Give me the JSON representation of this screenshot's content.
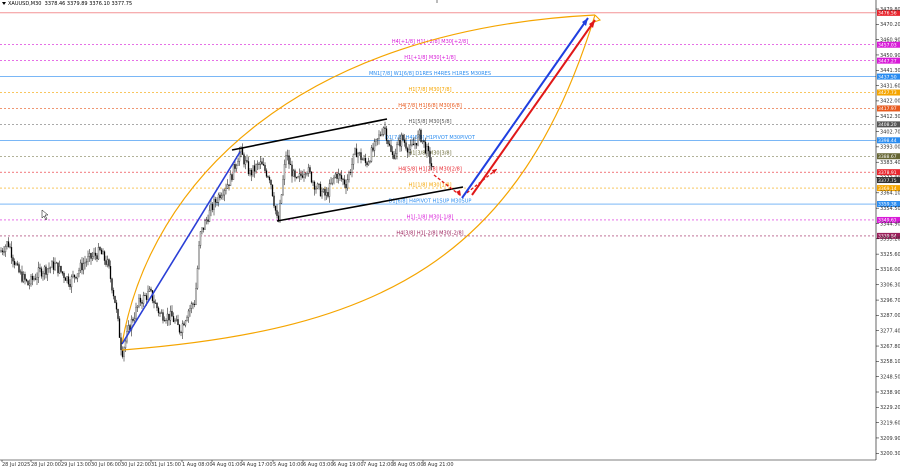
{
  "header": {
    "symbol": "XAUUSD,M30",
    "ohlc": "3378.46 3379.89 3376.10 3377.75"
  },
  "colors": {
    "candle": "#000000",
    "grid": "#c8c8c8",
    "channel": "#000000",
    "impulse": "#2a3fd6",
    "arc": "#f5a500",
    "up_blue": "#1f3fe0",
    "up_red": "#e01818",
    "dash_red": "#e01818"
  },
  "chart_data": {
    "type": "candlestick",
    "title": "",
    "xlabel": "",
    "ylabel": "",
    "ylim": [
      3200.0,
      3482.0
    ],
    "y_ticks": [
      "3479.80",
      "3470.20",
      "3460.90",
      "3450.90",
      "3441.30",
      "3431.60",
      "3422.00",
      "3412.30",
      "3402.70",
      "3393.00",
      "3383.40",
      "3373.80",
      "3364.10",
      "3354.50",
      "3344.90",
      "3335.20",
      "3325.60",
      "3316.00",
      "3306.30",
      "3296.70",
      "3287.00",
      "3277.40",
      "3267.80",
      "3258.10",
      "3248.50",
      "3238.90",
      "3229.20",
      "3219.60",
      "3209.90",
      "3200.30"
    ],
    "x_ticks": [
      "28 Jul 2025",
      "28 Jul 20:00",
      "29 Jul 13:00",
      "30 Jul 06:00",
      "30 Jul 22:00",
      "31 Jul 15:00",
      "1 Aug 08:00",
      "4 Aug 01:00",
      "4 Aug 17:00",
      "5 Aug 10:00",
      "6 Aug 03:00",
      "6 Aug 19:00",
      "7 Aug 12:00",
      "8 Aug 05:00",
      "8 Aug 21:00"
    ],
    "grid": false,
    "price_levels": [
      {
        "price": 3476.56,
        "label": "",
        "color": "#e8262e",
        "style": "solid",
        "badge": "3476.56"
      },
      {
        "price": 3457.03,
        "label": "H4[+1/8] H1[+2/8] M30[+2/8]",
        "color": "#d81bd8",
        "style": "dashed",
        "badge": "3457.03"
      },
      {
        "price": 3447.27,
        "label": "H1[+1/8] M30[+1/8]",
        "color": "#d81bd8",
        "style": "dashed",
        "badge": "3447.27"
      },
      {
        "price": 3437.5,
        "label": "MN1[7/8] W1[6/8] D1RES H4RES H1RES M30RES",
        "color": "#2a8cf0",
        "style": "solid",
        "badge": "3437.50"
      },
      {
        "price": 3427.73,
        "label": "H1[7/8] M30[7/8]",
        "color": "#f5a500",
        "style": "dashed",
        "badge": "3427.73"
      },
      {
        "price": 3417.97,
        "label": "H4[7/8] H1[6/8] M30[6/8]",
        "color": "#e85a1e",
        "style": "dashed",
        "badge": "3417.97"
      },
      {
        "price": 3408.2,
        "label": "H1[5/8] M30[5/8]",
        "color": "#555555",
        "style": "dashed",
        "badge": "3408.20"
      },
      {
        "price": 3398.44,
        "label": "D1[7/8] H4[6/8] H1PIVOT M30PIVOT",
        "color": "#2a8cf0",
        "style": "solid",
        "badge": "3398.44"
      },
      {
        "price": 3388.67,
        "label": "H1[3/8] M30[3/8]",
        "color": "#666633",
        "style": "dashed",
        "badge": "3388.67"
      },
      {
        "price": 3378.91,
        "label": "H4[5/8] H1[2/8] M30[2/8]",
        "color": "#e8262e",
        "style": "dashed",
        "badge": "3378.91"
      },
      {
        "price": 3369.14,
        "label": "H1[1/8] M30[1/8]",
        "color": "#f5a500",
        "style": "dashed",
        "badge": "3369.14"
      },
      {
        "price": 3359.38,
        "label": "D1[6/8] H4PIVOT H1SUP M30SUP",
        "color": "#2a8cf0",
        "style": "solid",
        "badge": "3359.38"
      },
      {
        "price": 3349.61,
        "label": "H1[-1/8] M30[-1/8]",
        "color": "#d81bd8",
        "style": "dashed",
        "badge": "3349.61"
      },
      {
        "price": 3339.84,
        "label": "H4[3/8] H1[-2/8] M30[-2/8]",
        "color": "#9a1f5a",
        "style": "dashed",
        "badge": "3339.84"
      }
    ],
    "current_price": {
      "price": 3377.75,
      "badge": "3377.75"
    }
  }
}
